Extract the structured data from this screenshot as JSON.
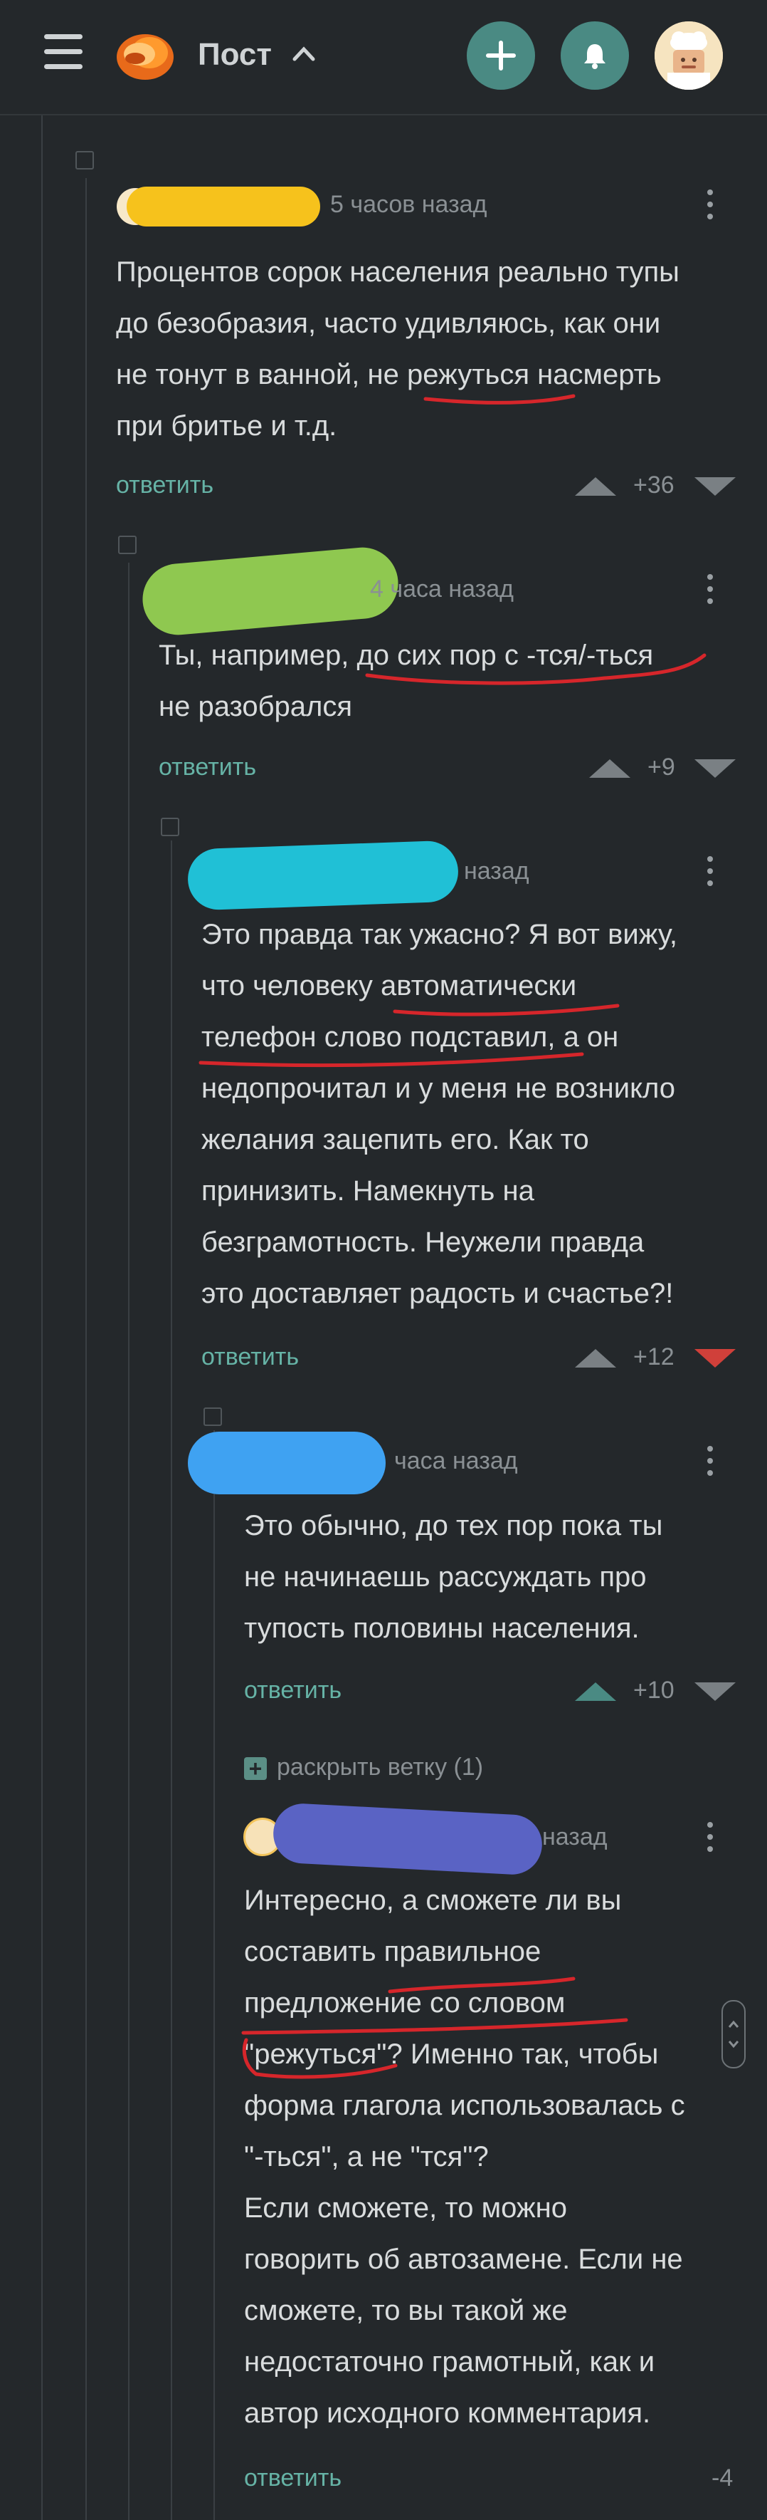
{
  "header": {
    "title": "Пост",
    "chevron": "^"
  },
  "comments": [
    {
      "time": "5 часов назад",
      "text": [
        "Процентов сорок населения реально тупы",
        "до безобразия, часто удивляюсь, как они",
        "не тонут в ванной, не режуться насмерть",
        "при бритье и т.д."
      ],
      "reply": "ответить",
      "score": "+36"
    },
    {
      "time": "4 часа назад",
      "text": [
        "Ты, например, до сих пор с -тся/-ться",
        "не разобрался"
      ],
      "reply": "ответить",
      "score": "+9"
    },
    {
      "time": "назад",
      "text": [
        "Это правда так ужасно? Я вот вижу,",
        "что человеку автоматически",
        "телефон слово подставил, а он",
        "недопрочитал и у меня не возникло",
        "желания зацепить его. Как то",
        "принизить. Намекнуть на",
        "безграмотность. Неужели правда",
        "это доставляет радость и счастье?!"
      ],
      "reply": "ответить",
      "score": "+12"
    },
    {
      "time": "часа назад",
      "text": [
        "Это обычно, до тех пор пока ты",
        "не начинаешь рассуждать про",
        "тупость половины населения."
      ],
      "reply": "ответить",
      "score": "+10"
    },
    {
      "time": "назад",
      "text": [
        "Интересно, а сможете ли вы",
        "составить правильное",
        "предложение со словом",
        "\"режуться\"? Именно так, чтобы",
        "форма глагола использовалась с",
        "\"-ться\", а не \"тся\"?",
        "Если сможете, то можно",
        "говорить об автозамене. Если не",
        "сможете, то вы такой же",
        "недостаточно грамотный, как и",
        "автор исходного комментария."
      ],
      "reply": "ответить",
      "score": "-4"
    }
  ],
  "expand_branch": "раскрыть ветку (1)",
  "colors": {
    "accent": "#4a8a83",
    "reply_link": "#66b3a6",
    "downvote_active": "#d0403a",
    "blob_yellow": "#f6c21c",
    "blob_green": "#8fc850",
    "blob_cyan": "#20c0d6",
    "blob_blue": "#3fa2f2",
    "blob_purple": "#5a63c4",
    "underline": "#d6262b"
  },
  "icons": [
    "menu-icon",
    "logo-icon",
    "plus-icon",
    "bell-icon",
    "avatar-icon",
    "more-icon",
    "upvote-icon",
    "downvote-icon",
    "expand-icon"
  ]
}
